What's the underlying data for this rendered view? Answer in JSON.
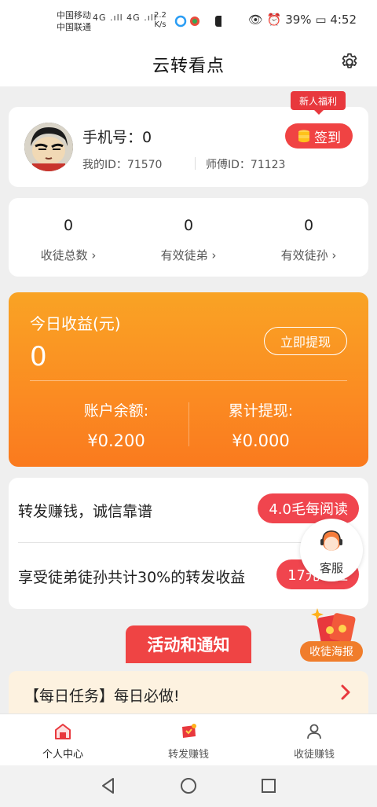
{
  "status_bar": {
    "carrier_1": "中国移动",
    "carrier_2": "中国联通",
    "network": "4G .ıll 4G .ıll",
    "speed_value": "2.2",
    "speed_unit": "K/s",
    "battery": "39%",
    "time": "4:52"
  },
  "header": {
    "title": "云转看点"
  },
  "profile": {
    "phone_label": "手机号：0",
    "my_id": "我的ID：71570",
    "master_id": "师傅ID：71123",
    "signin_label": "签到",
    "newbie_badge": "新人福利"
  },
  "stats": [
    {
      "value": "0",
      "label": "收徒总数 ›"
    },
    {
      "value": "0",
      "label": "有效徒弟 ›"
    },
    {
      "value": "0",
      "label": "有效徒孙 ›"
    }
  ],
  "earnings": {
    "title": "今日收益(元)",
    "value": "0",
    "withdraw_label": "立即提现",
    "balance_label": "账户余额:",
    "balance_value": "¥0.200",
    "total_label": "累计提现:",
    "total_value": "¥0.000"
  },
  "promo": [
    {
      "text": "转发赚钱，诚信靠谱",
      "pill": "4.0毛每阅读"
    },
    {
      "text": "享受徒弟徒孙共计30%的转发收益",
      "pill": "17元每位"
    }
  ],
  "service": {
    "label": "客服"
  },
  "notice": {
    "tab_label": "活动和通知"
  },
  "poster": {
    "label": "收徒海报"
  },
  "daily_task": {
    "text": "【每日任务】每日必做!"
  },
  "tabbar": [
    {
      "label": "个人中心",
      "icon": "home-icon"
    },
    {
      "label": "转发赚钱",
      "icon": "share-money-icon"
    },
    {
      "label": "收徒赚钱",
      "icon": "recruit-icon"
    }
  ],
  "colors": {
    "accent_red": "#f04343",
    "orange": "#fb8b22",
    "tab_active": "#e8383d"
  }
}
